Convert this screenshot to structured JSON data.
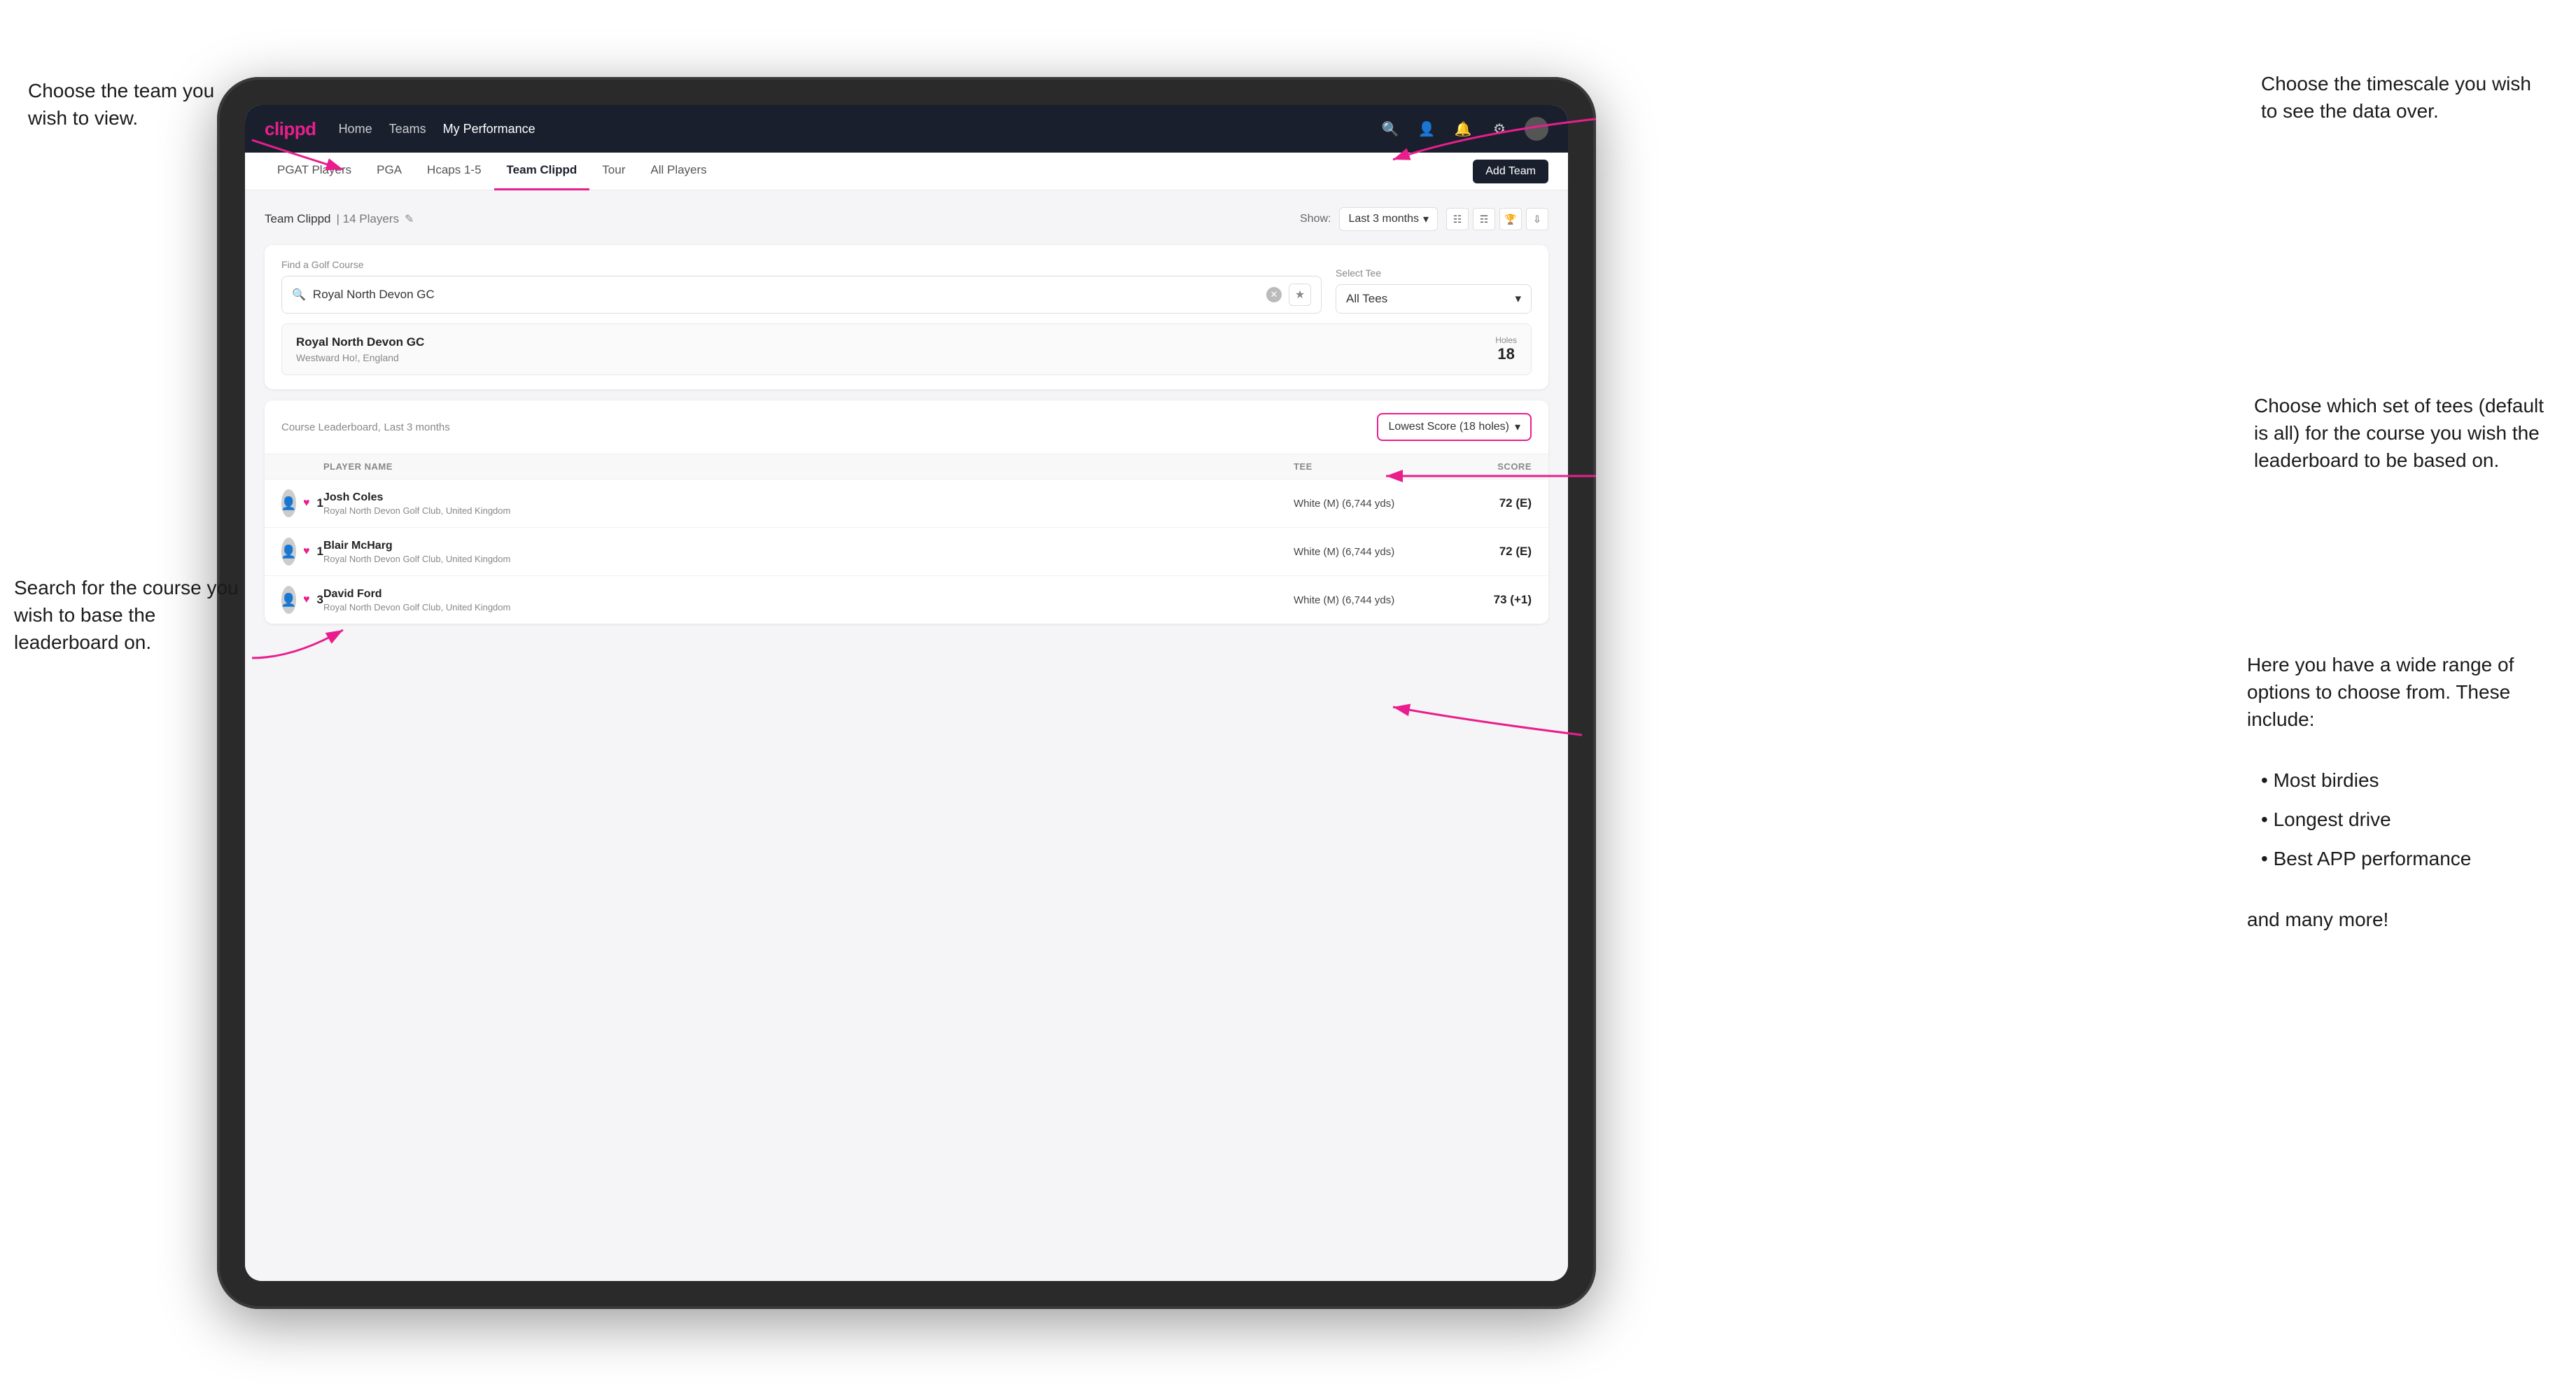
{
  "annotations": {
    "top_left_title": "Choose the team you\nwish to view.",
    "middle_left_title": "Search for the course\nyou wish to base the\nleaderboard on.",
    "top_right_title": "Choose the timescale you\nwish to see the data over.",
    "middle_right_title": "Choose which set of tees\n(default is all) for the course\nyou wish the leaderboard to\nbe based on.",
    "bottom_right_title": "Here you have a wide range\nof options to choose from.\nThese include:",
    "bullet_1": "Most birdies",
    "bullet_2": "Longest drive",
    "bullet_3": "Best APP performance",
    "and_more": "and many more!"
  },
  "navbar": {
    "logo": "clippd",
    "links": [
      "Home",
      "Teams",
      "My Performance"
    ],
    "active_link": "My Performance"
  },
  "subnav": {
    "items": [
      "PGAT Players",
      "PGA",
      "Hcaps 1-5",
      "Team Clippd",
      "Tour",
      "All Players"
    ],
    "active_item": "Team Clippd",
    "add_team_label": "Add Team"
  },
  "team_header": {
    "title": "Team Clippd",
    "player_count": "14 Players",
    "show_label": "Show:",
    "show_value": "Last 3 months"
  },
  "course_search": {
    "find_label": "Find a Golf Course",
    "search_value": "Royal North Devon GC",
    "select_tee_label": "Select Tee",
    "tee_value": "All Tees",
    "course_name": "Royal North Devon GC",
    "course_location": "Westward Ho!, England",
    "holes_label": "Holes",
    "holes_value": "18"
  },
  "leaderboard": {
    "title": "Course Leaderboard,",
    "subtitle": "Last 3 months",
    "score_type": "Lowest Score (18 holes)",
    "columns": {
      "player_name": "PLAYER NAME",
      "tee": "TEE",
      "score": "SCORE"
    },
    "rows": [
      {
        "rank": "1",
        "name": "Josh Coles",
        "club": "Royal North Devon Golf Club, United Kingdom",
        "tee": "White (M) (6,744 yds)",
        "score": "72 (E)",
        "avatar_color": "#888"
      },
      {
        "rank": "1",
        "name": "Blair McHarg",
        "club": "Royal North Devon Golf Club, United Kingdom",
        "tee": "White (M) (6,744 yds)",
        "score": "72 (E)",
        "avatar_color": "#999"
      },
      {
        "rank": "3",
        "name": "David Ford",
        "club": "Royal North Devon Golf Club, United Kingdom",
        "tee": "White (M) (6,744 yds)",
        "score": "73 (+1)",
        "avatar_color": "#aaa"
      }
    ]
  }
}
